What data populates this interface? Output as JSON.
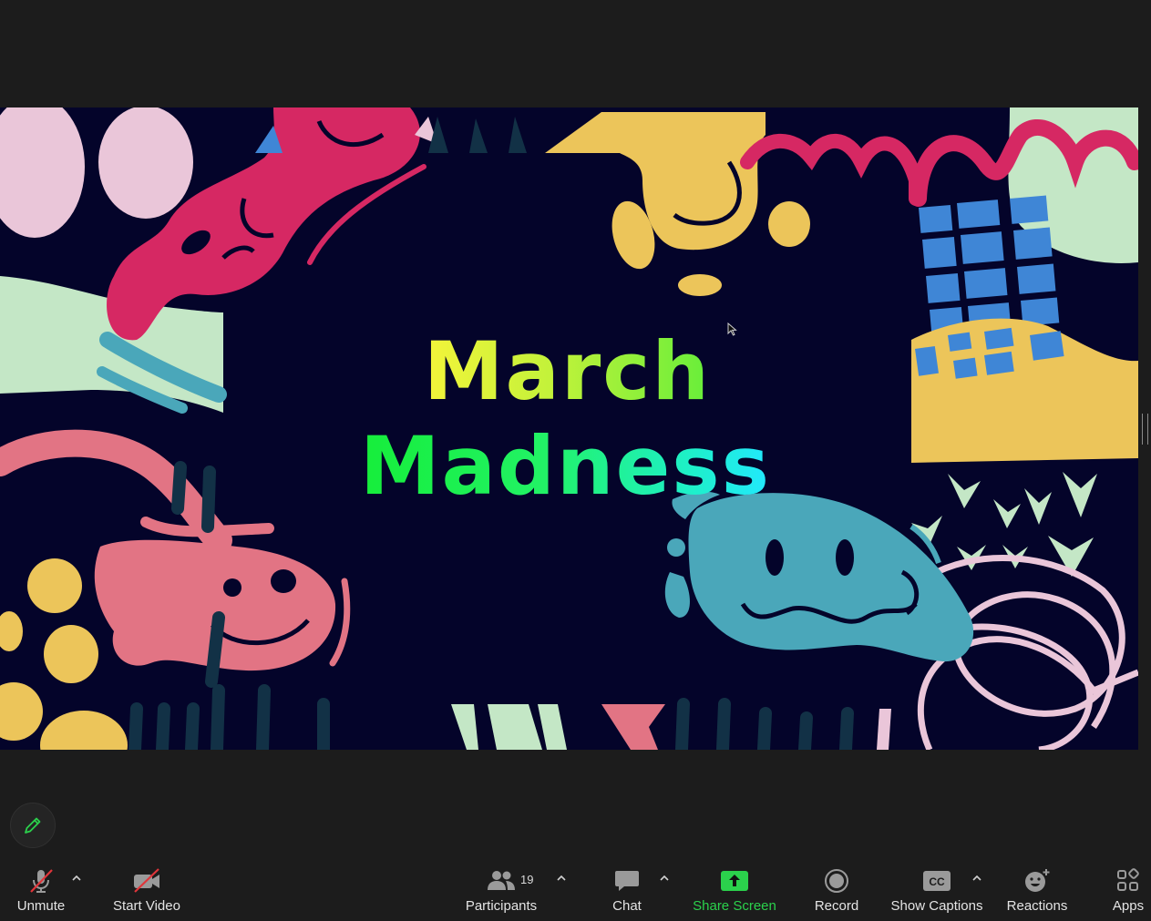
{
  "slide": {
    "title_line_1": "March",
    "title_line_2": "Madness"
  },
  "toolbar": {
    "unmute": {
      "label": "Unmute",
      "icon": "mic-muted-icon"
    },
    "start_video": {
      "label": "Start Video",
      "icon": "video-off-icon"
    },
    "participants": {
      "label": "Participants",
      "count": "19",
      "icon": "participants-icon"
    },
    "chat": {
      "label": "Chat",
      "icon": "chat-icon"
    },
    "share_screen": {
      "label": "Share Screen",
      "icon": "share-screen-icon"
    },
    "record": {
      "label": "Record",
      "icon": "record-icon"
    },
    "show_captions": {
      "label": "Show Captions",
      "icon": "cc-icon",
      "icon_text": "CC"
    },
    "reactions": {
      "label": "Reactions",
      "icon": "reactions-icon"
    },
    "apps": {
      "label": "Apps",
      "icon": "apps-icon"
    }
  },
  "colors": {
    "background": "#1c1c1c",
    "slide_background": "#04042a",
    "share_green": "#2bd14c",
    "muted_red": "#e0353a",
    "label": "#e4e4e4"
  }
}
